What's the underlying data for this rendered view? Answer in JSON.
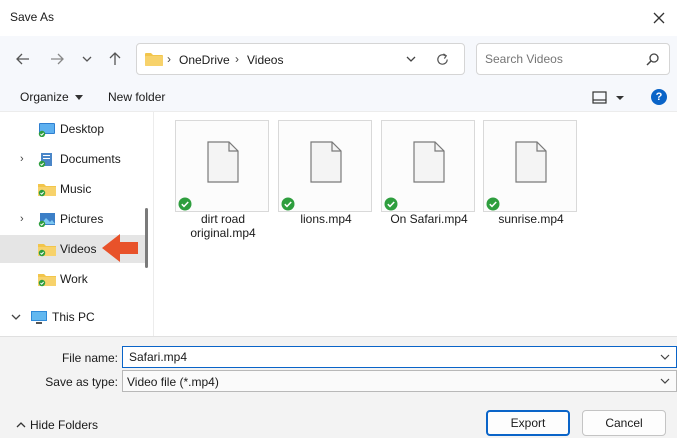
{
  "window": {
    "title": "Save As"
  },
  "address": {
    "path": [
      "OneDrive",
      "Videos"
    ]
  },
  "search": {
    "placeholder": "Search Videos"
  },
  "toolbar": {
    "organize_label": "Organize",
    "new_folder_label": "New folder"
  },
  "sidebar": {
    "items": [
      {
        "label": "Desktop",
        "icon": "desktop-icon"
      },
      {
        "label": "Documents",
        "icon": "documents-icon"
      },
      {
        "label": "Music",
        "icon": "music-folder-icon"
      },
      {
        "label": "Pictures",
        "icon": "pictures-icon"
      },
      {
        "label": "Videos",
        "icon": "videos-folder-icon",
        "selected": true
      },
      {
        "label": "Work",
        "icon": "work-folder-icon"
      },
      {
        "label": "This PC",
        "icon": "this-pc-icon"
      }
    ]
  },
  "files": [
    {
      "name_line1": "dirt road",
      "name_line2": "original.mp4"
    },
    {
      "name_line1": "lions.mp4",
      "name_line2": ""
    },
    {
      "name_line1": "On Safari.mp4",
      "name_line2": ""
    },
    {
      "name_line1": "sunrise.mp4",
      "name_line2": ""
    }
  ],
  "form": {
    "file_name_label": "File name:",
    "file_name_value": "Safari.mp4",
    "save_type_label": "Save as type:",
    "save_type_value": "Video file (*.mp4)"
  },
  "footer": {
    "hide_folders_label": "Hide Folders",
    "export_label": "Export",
    "cancel_label": "Cancel"
  },
  "colors": {
    "accent": "#0a64c8",
    "sync_check": "#2e9e3e",
    "folder": "#f2c54b",
    "annotation_arrow": "#e8522a"
  }
}
